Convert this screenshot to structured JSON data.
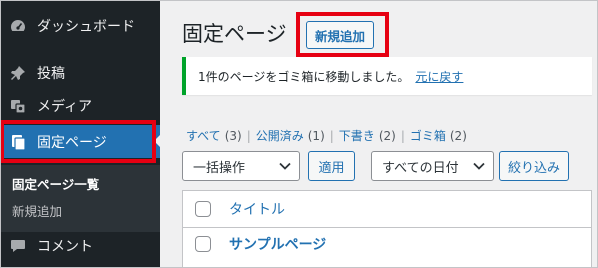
{
  "sidebar": {
    "items": [
      {
        "label": "ダッシュボード",
        "icon": "dashboard-icon"
      },
      {
        "label": "投稿",
        "icon": "pushpin-icon"
      },
      {
        "label": "メディア",
        "icon": "media-icon"
      },
      {
        "label": "固定ページ",
        "icon": "pages-icon"
      },
      {
        "label": "コメント",
        "icon": "comment-icon"
      }
    ],
    "submenu": [
      {
        "label": "固定ページ一覧"
      },
      {
        "label": "新規追加"
      }
    ]
  },
  "header": {
    "title": "固定ページ",
    "add_new_label": "新規追加"
  },
  "notice": {
    "message": "1件のページをゴミ箱に移動しました。",
    "undo_label": "元に戻す"
  },
  "filters": [
    {
      "label": "すべて",
      "count": "(3)"
    },
    {
      "label": "公開済み",
      "count": "(1)"
    },
    {
      "label": "下書き",
      "count": "(2)"
    },
    {
      "label": "ゴミ箱",
      "count": "(2)"
    }
  ],
  "toolbar": {
    "bulk_action": "一括操作",
    "apply_label": "適用",
    "date_filter": "すべての日付",
    "filter_label": "絞り込み"
  },
  "table": {
    "column_title": "タイトル",
    "rows": [
      {
        "title": "サンプルページ"
      }
    ]
  },
  "colors": {
    "sidebar_bg": "#1d2327",
    "active_menu": "#2271b1",
    "highlight_box": "#e60012",
    "notice_border": "#00a32a",
    "link": "#2271b1"
  }
}
